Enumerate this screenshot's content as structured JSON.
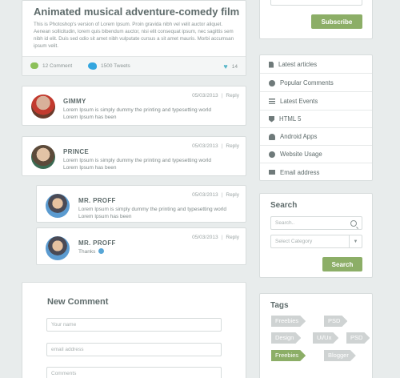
{
  "article": {
    "title": "Animated musical adventure-comedy film",
    "body": "This is Photoshop's version  of Lorem Ipsum. Proin gravida nibh vel velit auctor aliquet. Aenean sollicitudin, lorem quis bibendum auctor, nisi elit consequat ipsum, nec sagittis sem nibh id elit. Duis sed odio sit amet nibh vulputate cursus a sit amet mauris. Morbi accumsan ipsum velit.",
    "comments_count": "12 Comment",
    "tweets_count": "1500 Tweets",
    "likes": "14"
  },
  "comments": [
    {
      "name": "GIMMY",
      "date": "05/03/2013",
      "reply": "Reply",
      "text": "Lorem Ipsum is simply dummy the printing and typesetting world Lorem Ipsum has been"
    },
    {
      "name": "PRINCE",
      "date": "05/03/2013",
      "reply": "Reply",
      "text": "Lorem Ipsum is simply dummy the printing and typesetting world Lorem Ipsum has been"
    },
    {
      "name": "MR. PROFF",
      "date": "05/03/2013",
      "reply": "Reply",
      "text": "Lorem Ipsum is simply dummy the printing and typesetting world Lorem Ipsum has been"
    },
    {
      "name": "MR. PROFF",
      "date": "05/03/2013",
      "reply": "Reply",
      "text": "Thanks"
    }
  ],
  "new_comment": {
    "title": "New Comment",
    "name_placeholder": "Your name",
    "email_placeholder": "email address",
    "comments_placeholder": "Comments"
  },
  "subscribe": {
    "button": "Subscribe"
  },
  "menu": {
    "items": [
      {
        "label": "Latest articles",
        "icon": "document-icon"
      },
      {
        "label": "Popular Comments",
        "icon": "comment-icon"
      },
      {
        "label": "Latest Events",
        "icon": "list-icon"
      },
      {
        "label": "HTML 5",
        "icon": "html5-icon"
      },
      {
        "label": "Android Apps",
        "icon": "android-icon"
      },
      {
        "label": "Website Usage",
        "icon": "dashboard-icon"
      },
      {
        "label": "Email address",
        "icon": "mail-icon"
      }
    ]
  },
  "search": {
    "title": "Search",
    "placeholder": "Search..",
    "category_placeholder": "Select Category",
    "button": "Search"
  },
  "tags": {
    "title": "Tags",
    "items": [
      "Freebies",
      "PSD",
      "Design",
      "Ui/Ux",
      "PSD",
      "Freebies",
      "Blogger"
    ]
  },
  "colors": {
    "accent": "#8cae67",
    "tag_gray": "#cfd3d3",
    "text": "#5e6b6b"
  }
}
